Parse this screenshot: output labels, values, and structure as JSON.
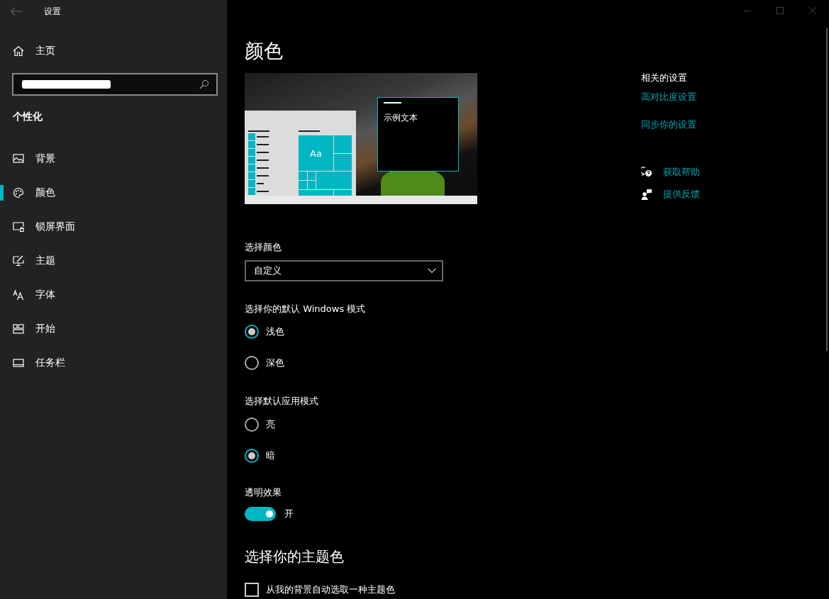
{
  "window": {
    "title": "设置"
  },
  "sidebar": {
    "home": "主页",
    "section": "个性化",
    "items": [
      {
        "label": "背景",
        "kind": "image",
        "selected": false
      },
      {
        "label": "颜色",
        "kind": "palette",
        "selected": true
      },
      {
        "label": "锁屏界面",
        "kind": "lockscreen",
        "selected": false
      },
      {
        "label": "主题",
        "kind": "theme",
        "selected": false
      },
      {
        "label": "字体",
        "kind": "font",
        "selected": false
      },
      {
        "label": "开始",
        "kind": "start",
        "selected": false
      },
      {
        "label": "任务栏",
        "kind": "taskbar",
        "selected": false
      }
    ]
  },
  "page": {
    "title": "颜色",
    "preview": {
      "tile_text": "Aa",
      "sample_text": "示例文本"
    },
    "color_select": {
      "label": "选择颜色",
      "value": "自定义"
    },
    "radio_groups": [
      {
        "label": "选择你的默认 Windows 模式",
        "options": [
          {
            "label": "浅色",
            "selected": true
          },
          {
            "label": "深色",
            "selected": false
          }
        ]
      },
      {
        "label": "选择默认应用模式",
        "options": [
          {
            "label": "亮",
            "selected": false
          },
          {
            "label": "暗",
            "selected": true
          }
        ]
      }
    ],
    "transparency": {
      "label": "透明效果",
      "on": true,
      "state_text": "开"
    },
    "accent_heading": "选择你的主题色",
    "auto_accent": {
      "label": "从我的背景自动选取一种主题色",
      "checked": false
    }
  },
  "related": {
    "heading": "相关的设置",
    "links": [
      "高对比度设置",
      "同步你的设置"
    ],
    "help": [
      {
        "label": "获取帮助",
        "kind": "help"
      },
      {
        "label": "提供反馈",
        "kind": "feedback"
      }
    ]
  }
}
